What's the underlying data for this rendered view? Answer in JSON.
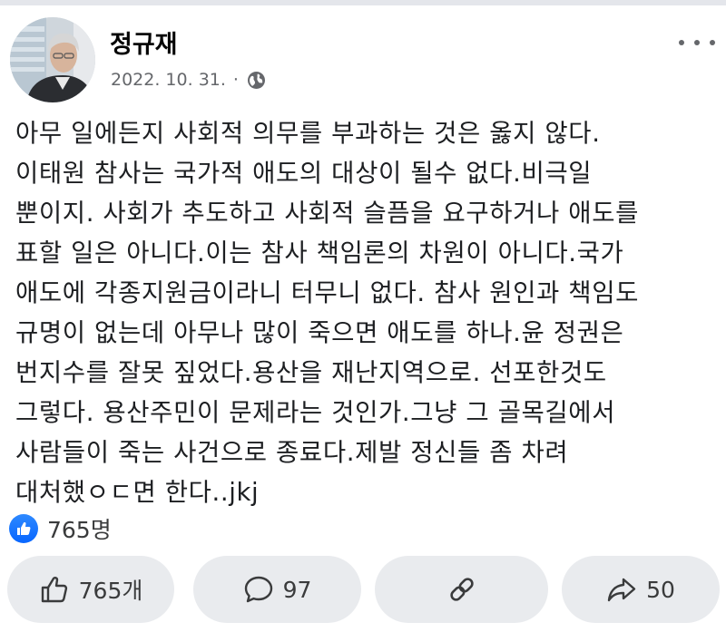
{
  "post": {
    "author": "정규재",
    "date": "2022. 10. 31.",
    "separator": "·",
    "privacy_icon": "globe-icon",
    "more_icon": "more-horizontal-icon",
    "lines": [
      "아무 일에든지 사회적 의무를 부과하는 것은 옳지 않다.",
      "이태원 참사는 국가적 애도의 대상이 될수 없다.비극일",
      "뿐이지. 사회가 추도하고 사회적 슬픔을 요구하거나 애도를",
      "표할 일은 아니다.이는 참사 책임론의 차원이 아니다.국가",
      "애도에 각종지원금이라니 터무니 없다. 참사 원인과 책임도",
      "규명이 없는데 아무나 많이 죽으면 애도를 하나.윤 정권은",
      "번지수를 잘못 짚었다.용산을 재난지역으로. 선포한것도",
      "그렇다. 용산주민이 문제라는 것인가.그냥 그 골목길에서",
      "사람들이 죽는 사건으로 종료다.제발 정신들 좀 차려",
      "대처했ㅇㄷ면 한다..jkj"
    ]
  },
  "reactions": {
    "icon": "like-badge-icon",
    "count": "765명"
  },
  "actions": {
    "like_label": "765개",
    "comment_label": "97",
    "share_label": "",
    "forward_label": "50"
  },
  "colors": {
    "like_blue": "#0866ff",
    "button_bg": "#e9ebee",
    "meta_gray": "#65676b"
  }
}
